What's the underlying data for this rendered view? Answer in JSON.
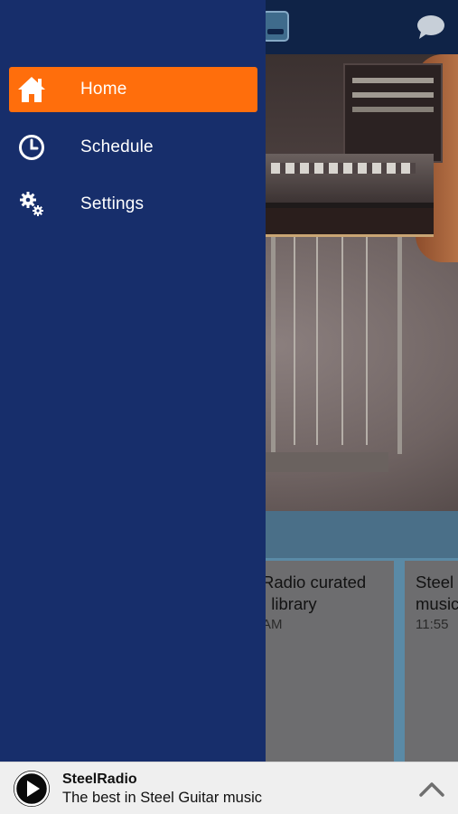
{
  "drawer": {
    "items": [
      {
        "label": "Home",
        "icon": "home-icon",
        "active": true
      },
      {
        "label": "Schedule",
        "icon": "clock-icon",
        "active": false
      },
      {
        "label": "Settings",
        "icon": "gears-icon",
        "active": false
      }
    ]
  },
  "background": {
    "cards": [
      {
        "title": "Radio curated\n: library",
        "time": "AM"
      },
      {
        "title": "Steel\nmusic",
        "time": "11:55"
      }
    ]
  },
  "player": {
    "title": "SteelRadio",
    "subtitle": "The best in Steel Guitar music",
    "play_icon": "play-icon",
    "expand_icon": "chevron-up-icon"
  },
  "colors": {
    "drawer_bg": "#172e6b",
    "active_item": "#ff6e0c",
    "header_bg": "#0f2347",
    "player_bg": "#efefef"
  }
}
